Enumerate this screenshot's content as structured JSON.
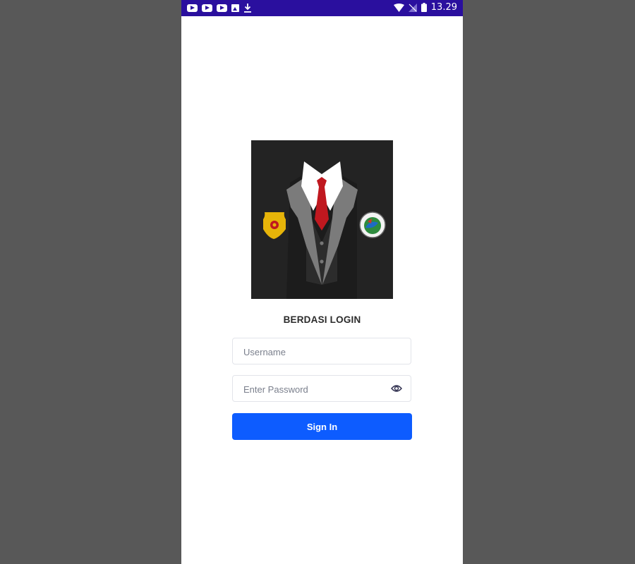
{
  "status_bar": {
    "time": "13.29",
    "notification_icons": [
      "youtube-icon",
      "youtube-icon",
      "youtube-icon",
      "image-icon",
      "download-icon"
    ],
    "system_icons": [
      "wifi-icon",
      "signal-icon",
      "battery-icon"
    ],
    "background": "#2a0f9e"
  },
  "login": {
    "title": "BERDASI LOGIN",
    "username_placeholder": "Username",
    "password_placeholder": "Enter Password",
    "signin_label": "Sign In",
    "accent": "#0d5cff"
  }
}
